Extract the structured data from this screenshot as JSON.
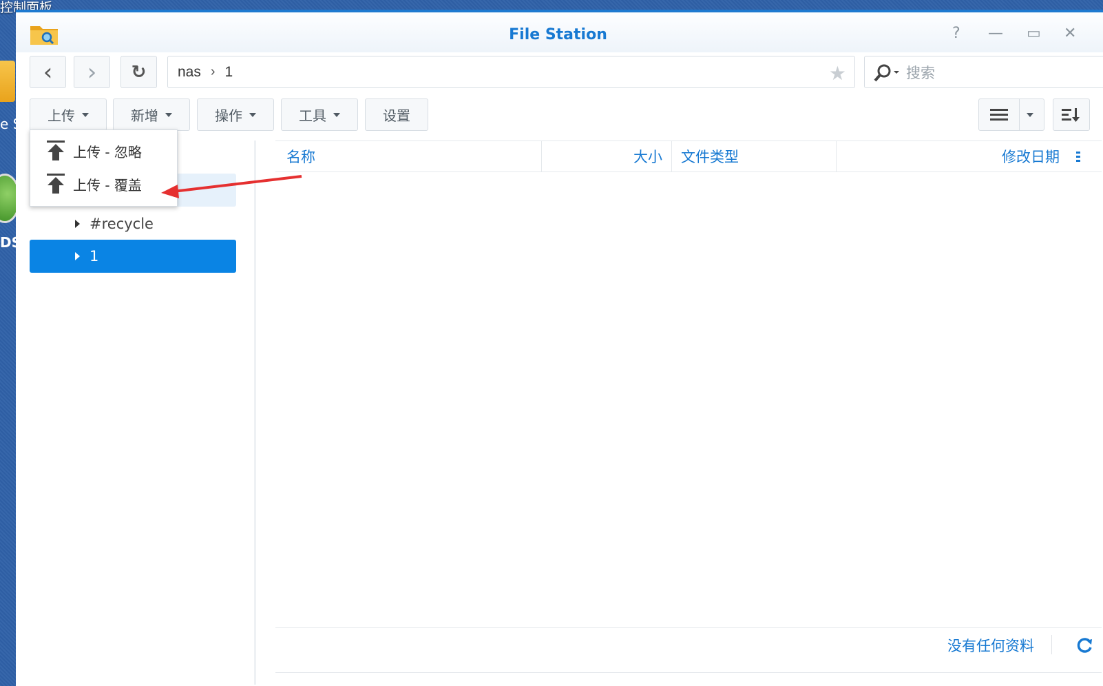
{
  "desktop": {
    "top_label": "控制面板",
    "side_text_1": "e S",
    "side_text_2": "DSI"
  },
  "window": {
    "title": "File Station",
    "controls": {
      "help": "?",
      "minimize": "—",
      "maximize": "▭",
      "close": "✕"
    }
  },
  "nav": {
    "back_icon": "‹",
    "forward_icon": "›",
    "refresh_icon": "↻"
  },
  "path": {
    "segments": [
      "nas",
      "1"
    ],
    "separator": "›",
    "star_icon": "★"
  },
  "search": {
    "placeholder": "搜索"
  },
  "toolbar": {
    "upload": "上传",
    "create": "新增",
    "action": "操作",
    "tools": "工具",
    "settings": "设置"
  },
  "upload_menu": {
    "items": [
      "上传 - 忽略",
      "上传 - 覆盖"
    ]
  },
  "tree": {
    "items": [
      "#recycle",
      "1"
    ]
  },
  "grid": {
    "columns": [
      "名称",
      "大小",
      "文件类型",
      "修改日期"
    ]
  },
  "footer": {
    "status": "没有任何资料"
  },
  "colors": {
    "accent": "#1779d2",
    "selected": "#0a84e4",
    "annotation_arrow": "#e53030"
  }
}
